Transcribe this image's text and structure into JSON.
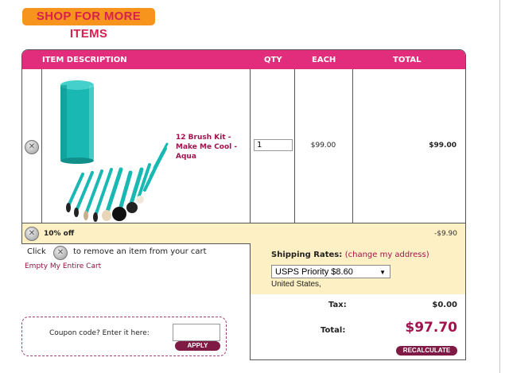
{
  "shop_button": {
    "label": "SHOP FOR MORE ITEMS"
  },
  "cart": {
    "columns": {
      "description": "ITEM DESCRIPTION",
      "qty": "QTY",
      "each": "EACH",
      "total": "TOTAL"
    },
    "item": {
      "name": "12 Brush Kit - Make Me Cool - Aqua",
      "qty": "1",
      "each": "$99.00",
      "total": "$99.00",
      "image_icon": "aqua-brush-kit-image"
    },
    "discount": {
      "label": "10% off",
      "amount": "-$9.90"
    },
    "remove_icon": "x-circle-icon"
  },
  "hint": {
    "part1": "Click",
    "part2": "to remove an item from your cart"
  },
  "empty_cart_link": "Empty My Entire Cart",
  "shipping": {
    "title": "Shipping Rates:",
    "change_link": "(change my address)",
    "selected_rate": "USPS Priority $8.60",
    "location": "United States,"
  },
  "summary": {
    "tax_label": "Tax:",
    "tax_value": "$0.00",
    "total_label": "Total:",
    "total_value": "$97.70"
  },
  "recalculate_button": "RECALCULATE",
  "coupon": {
    "label": "Coupon code? Enter it here:",
    "value": "",
    "apply_label": "APPLY"
  },
  "colors": {
    "accent": "#e22d7c",
    "brand_dark": "#7e1a43",
    "highlight": "#fdf0c4",
    "orange": "#f7941d",
    "price": "#a3124f"
  }
}
